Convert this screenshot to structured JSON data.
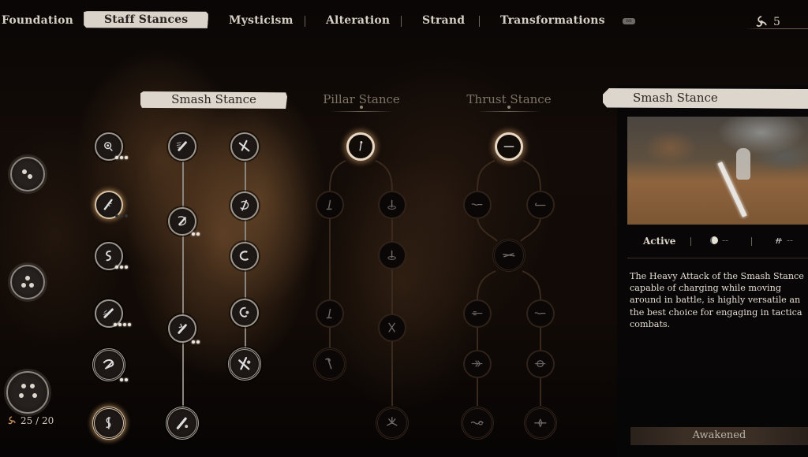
{
  "top_nav": {
    "tabs": [
      {
        "label": "Foundation",
        "active": false
      },
      {
        "label": "Staff Stances",
        "active": true
      },
      {
        "label": "Mysticism",
        "active": false
      },
      {
        "label": "Alteration",
        "active": false
      },
      {
        "label": "Strand",
        "active": false
      },
      {
        "label": "Transformations",
        "active": false
      }
    ],
    "badge_label": "RB",
    "points": {
      "icon": "triskelion-spark-icon",
      "value": "5"
    }
  },
  "left_orbs": {
    "orbs": [
      {
        "name": "focus-orb-1",
        "dots": 2
      },
      {
        "name": "focus-orb-2",
        "dots": 3
      },
      {
        "name": "focus-orb-3",
        "dots": 4
      }
    ],
    "count_label": "25 / 20",
    "count_icon": "triskelion-spark-icon"
  },
  "stances": [
    {
      "label": "Smash Stance",
      "selected": true
    },
    {
      "label": "Pillar Stance",
      "selected": false
    },
    {
      "label": "Thrust Stance",
      "selected": false
    }
  ],
  "skill_tree": {
    "smash": {
      "col1": [
        {
          "icon": "spinning-mace-icon",
          "pips": 3,
          "lit": 3
        },
        {
          "icon": "charged-staff-icon",
          "pips": 3,
          "lit": 0,
          "glow": true
        },
        {
          "icon": "hook-swing-icon",
          "pips": 3,
          "lit": 3
        },
        {
          "icon": "dash-staff-icon",
          "pips": 4,
          "lit": 4
        },
        {
          "icon": "whirl-staff-icon",
          "pips": 2,
          "lit": 2,
          "big": true
        },
        {
          "icon": "hook-crest-icon",
          "pips": 0,
          "lit": 0,
          "big": true,
          "glow": true
        }
      ],
      "col2": [
        {
          "icon": "dash-staff-icon",
          "pips": 0,
          "lit": 0
        },
        {
          "icon": "shield-staff-icon",
          "pips": 2,
          "lit": 2
        },
        {
          "icon": "leap-strike-icon",
          "pips": 2,
          "lit": 2
        },
        {
          "icon": "staff-impact-icon",
          "pips": 0,
          "lit": 0,
          "big": true
        }
      ],
      "col3": [
        {
          "icon": "cross-staff-icon",
          "pips": 0,
          "lit": 0
        },
        {
          "icon": "spin-slash-icon",
          "pips": 0,
          "lit": 0
        },
        {
          "icon": "crescent-icon",
          "pips": 0,
          "lit": 0
        },
        {
          "icon": "crescent-orb-icon",
          "pips": 0,
          "lit": 0
        },
        {
          "icon": "cross-orb-icon",
          "pips": 0,
          "lit": 0,
          "big": true
        }
      ]
    },
    "pillar": [
      {
        "icon": "pillar-staff-icon",
        "state": "unlocked"
      },
      {
        "icon": "pillar-root-icon",
        "state": "locked"
      },
      {
        "icon": "pillar-spin-icon",
        "state": "locked"
      },
      {
        "icon": "pillar-spin-icon",
        "state": "locked"
      },
      {
        "icon": "pillar-root-icon",
        "state": "locked"
      },
      {
        "icon": "pillar-cross-icon",
        "state": "locked"
      },
      {
        "icon": "pillar-hook-icon",
        "state": "locked"
      },
      {
        "icon": "pinwheel-icon",
        "state": "locked"
      }
    ],
    "thrust": [
      {
        "icon": "thrust-line-icon",
        "state": "unlocked"
      },
      {
        "icon": "thrust-curve-icon",
        "state": "locked"
      },
      {
        "icon": "thrust-hook-icon",
        "state": "locked"
      },
      {
        "icon": "thrust-blade-icon",
        "state": "locked"
      },
      {
        "icon": "thrust-wave-icon",
        "state": "locked"
      },
      {
        "icon": "thrust-curve-icon",
        "state": "locked"
      },
      {
        "icon": "thrust-feather-icon",
        "state": "locked"
      },
      {
        "icon": "thrust-ring-icon",
        "state": "locked"
      },
      {
        "icon": "thrust-knot-icon",
        "state": "locked"
      },
      {
        "icon": "thrust-star-icon",
        "state": "locked"
      }
    ]
  },
  "detail_panel": {
    "title": "Smash Stance",
    "status": "Active",
    "stat_1": {
      "icon": "focus-moon-icon",
      "value": "--"
    },
    "stat_2": {
      "icon": "spirit-claw-icon",
      "value": "--"
    },
    "description": "The Heavy Attack of the Smash Stance\ncapable of charging while moving\naround in battle, is highly versatile an\nthe best choice for engaging in tactica\ncombats.",
    "button_label": "Awakened"
  },
  "colors": {
    "accent_paper": "#dcd6cc",
    "text_light": "#d8d2c8",
    "ember_glow": "#d8a86e"
  }
}
